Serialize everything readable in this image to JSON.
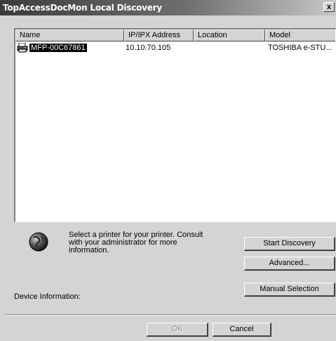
{
  "window": {
    "title": "TopAccessDocMon Local Discovery",
    "close_symbol": "x"
  },
  "list": {
    "columns": [
      "Name",
      "IP/IPX Address",
      "Location",
      "Model"
    ],
    "rows": [
      {
        "name": "MFP-00C67861",
        "ip": "10.10.70.105",
        "location": "",
        "model": "TOSHIBA e-STU..."
      }
    ]
  },
  "info": {
    "text": "Select a printer for your printer. Consult with your administrator for more information."
  },
  "buttons": {
    "start_discovery": "Start Discovery",
    "advanced": "Advanced...",
    "manual_selection": "Manual Selection",
    "ok": "OK",
    "cancel": "Cancel"
  },
  "device_info_label": "Device Information:",
  "icons": {
    "printer": "printer-icon",
    "globe": "globe-icon",
    "close": "close-icon"
  },
  "colors": {
    "face": "#d4d4d4",
    "selection": "#000000",
    "list_bg": "#ffffff"
  }
}
